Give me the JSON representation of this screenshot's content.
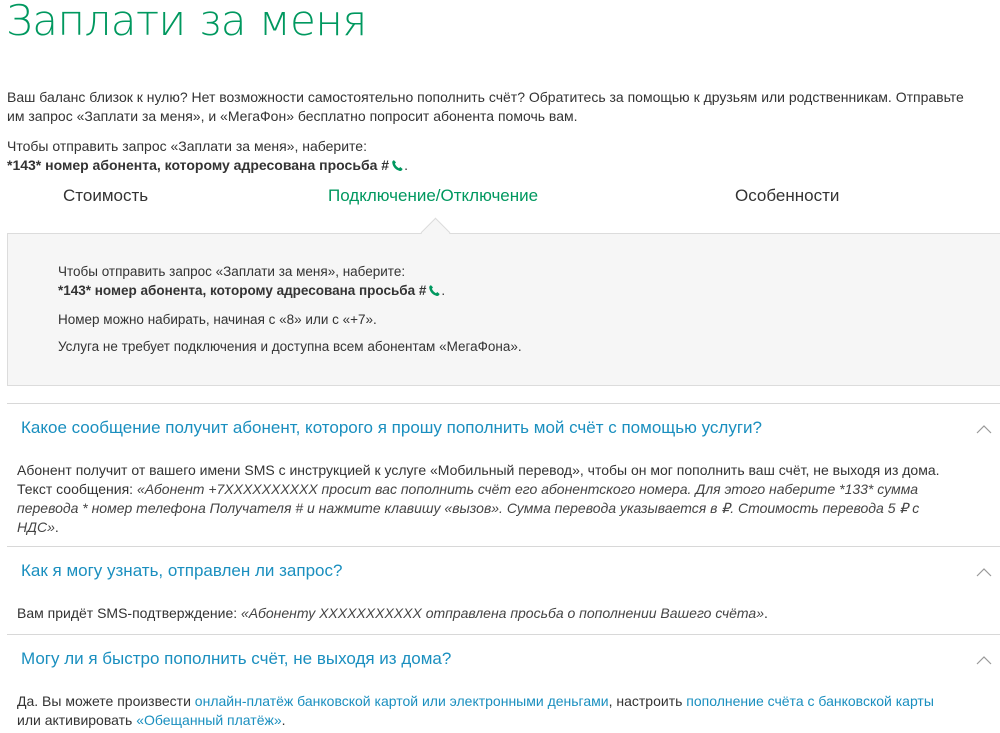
{
  "page": {
    "title": "Заплати за меня",
    "intro_line1": "Ваш баланс близок к нулю? Нет возможности самостоятельно пополнить счёт? Обратитесь за помощью к друзьям или родственникам. Отправьте",
    "intro_line2": "им запрос «Заплати за меня», и «МегаФон» бесплатно попросит абонента помочь вам.",
    "request_label": "Чтобы отправить запрос «Заплати за меня», наберите:",
    "request_code": "*143* номер абонента, которому адресована просьба #",
    "request_end": "."
  },
  "tabs": {
    "cost": "Стоимость",
    "connect": "Подключение/Отключение",
    "features": "Особенности"
  },
  "panel": {
    "line1": "Чтобы отправить запрос «Заплати за меня», наберите:",
    "code": "*143* номер абонента, которому адресована просьба #",
    "code_end": ".",
    "line2": "Номер можно набирать, начиная с «8» или с «+7».",
    "line3": "Услуга не требует подключения и доступна всем абонентам «МегаФона»."
  },
  "faq": [
    {
      "question": "Какое сообщение получит абонент, которого я прошу пополнить мой счёт с помощью услуги?",
      "a_plain": "Абонент получит от вашего имени SMS с инструкцией к услуге «Мобильный перевод», чтобы он мог пополнить ваш счёт, не выходя из дома. Текст сообщения: ",
      "a_italic": "«Абонент +7XXXXXXXXXX просит вас пополнить счёт его абонентского номера. Для этого наберите *133* сумма перевода * номер телефона Получателя # и нажмите клавишу «вызов». Сумма перевода указывается в ₽. Стоимость перевода 5 ₽ с НДС»",
      "a_end": "."
    },
    {
      "question": "Как я могу узнать, отправлен ли запрос?",
      "a_plain": "Вам придёт SMS-подтверждение: ",
      "a_italic": "«Абоненту XXXXXXXXXXX отправлена просьба о пополнении Вашего счёта»",
      "a_end": "."
    },
    {
      "question": "Могу ли я быстро пополнить счёт, не выходя из дома?",
      "a_p1": "Да. Вы можете произвести ",
      "a_link1": "онлайн-платёж банковской картой или электронными деньгами",
      "a_p2": ", настроить ",
      "a_link2": "пополнение счёта с банковской карты",
      "a_p3": " или активировать ",
      "a_link3": "«Обещанный платёж»",
      "a_p4": "."
    }
  ],
  "colors": {
    "brand_green": "#00985f",
    "link_blue": "#1a8fbf",
    "panel_bg": "#f6f6f6"
  },
  "icons": {
    "phone": "phone-handset-icon",
    "toggle": "chevron-up-icon"
  }
}
